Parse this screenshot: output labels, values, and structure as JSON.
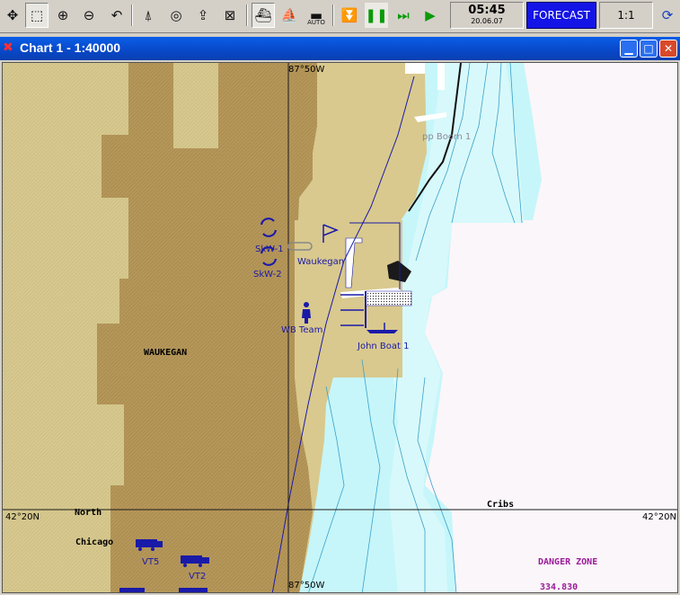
{
  "app": {
    "window_title": "Chart 1 - 1:40000"
  },
  "toolbar": {
    "auto_label": "AUTO",
    "time": "05:45",
    "date": "20.06.07",
    "forecast_label": "FORECAST",
    "scale_ratio": "1:1"
  },
  "chart": {
    "lon_label_top": "87°50W",
    "lon_label_bottom": "87°50W",
    "lat_label_left": "42°20N",
    "lat_label_right": "42°20N",
    "places": {
      "waukegan_land": "WAUKEGAN",
      "north": "North",
      "chicago": "Chicago",
      "cribs": "Cribs",
      "danger_zone": "DANGER ZONE",
      "danger_value": "334.830"
    },
    "objects": {
      "pp_boom": "pp Boom 1",
      "skw1": "SkW-1",
      "skw2": "SkW-2",
      "waukegan_marker": "Waukegan",
      "wb_team": "WB Team",
      "john_boat": "John Boat 1",
      "vt5": "VT5",
      "vt2": "VT2"
    },
    "colors": {
      "land_dark": "#b89a5a",
      "land_light": "#d8c88c",
      "water": "#c6f6fa",
      "deep_water": "#ffffff",
      "object_blue": "#1a1aa8",
      "danger": "#9a1b9a"
    }
  }
}
